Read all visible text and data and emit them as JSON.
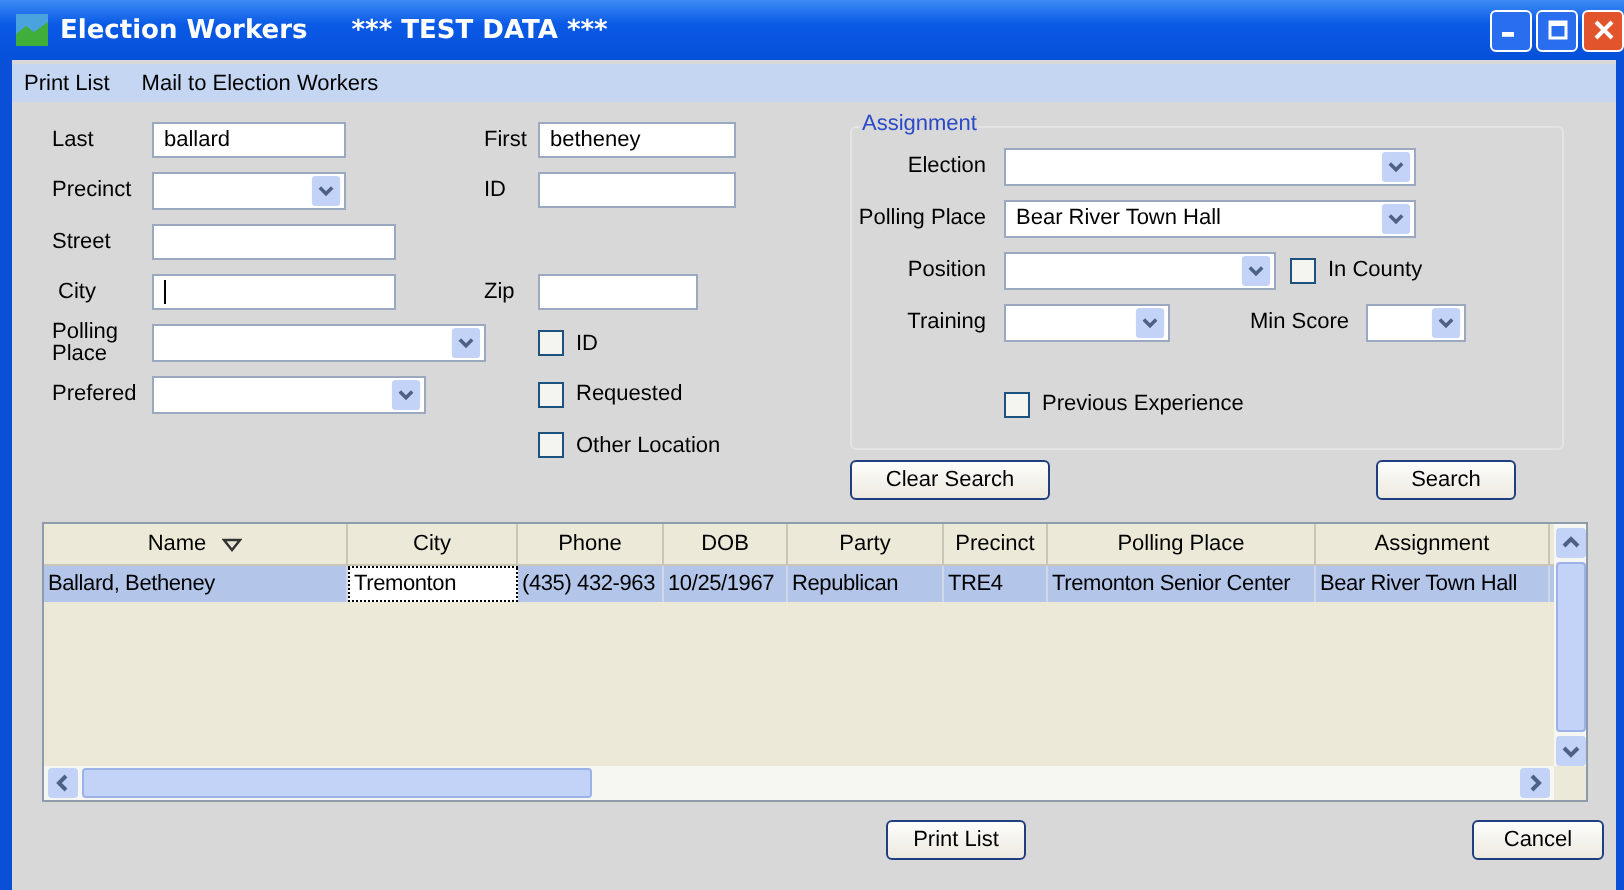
{
  "window": {
    "title": "Election Workers",
    "subtitle": "*** TEST DATA ***"
  },
  "menu": [
    {
      "label": "Print List"
    },
    {
      "label": "Mail to Election Workers"
    }
  ],
  "search": {
    "last": {
      "label": "Last",
      "value": "ballard"
    },
    "first": {
      "label": "First",
      "value": "betheney"
    },
    "precinct": {
      "label": "Precinct"
    },
    "id": {
      "label": "ID"
    },
    "street": {
      "label": "Street"
    },
    "city": {
      "label": "City",
      "focused": true
    },
    "zip": {
      "label": "Zip"
    },
    "polling_place": {
      "label_lines": [
        "Polling",
        "Place"
      ]
    },
    "prefered": {
      "label": "Prefered"
    },
    "checkboxes": [
      {
        "label": "ID",
        "checked": false
      },
      {
        "label": "Requested",
        "checked": false
      },
      {
        "label": "Other Location",
        "checked": false
      }
    ]
  },
  "assignment": {
    "legend": "Assignment",
    "election": {
      "label": "Election"
    },
    "polling_place": {
      "label": "Polling Place",
      "value": "Bear River Town Hall"
    },
    "position": {
      "label": "Position"
    },
    "in_county": {
      "label": "In County",
      "checked": false
    },
    "training": {
      "label": "Training"
    },
    "min_score": {
      "label": "Min Score"
    },
    "previous_experience": {
      "label": "Previous Experience",
      "checked": false
    }
  },
  "search_buttons": [
    {
      "label": "Clear Search"
    },
    {
      "label": "Search"
    }
  ],
  "table": {
    "columns": [
      {
        "label": "Name",
        "sorted": true
      },
      {
        "label": "City",
        "sorted": false
      },
      {
        "label": "Phone",
        "sorted": false
      },
      {
        "label": "DOB",
        "sorted": false
      },
      {
        "label": "Party",
        "sorted": false
      },
      {
        "label": "Precinct",
        "sorted": false
      },
      {
        "label": "Polling Place",
        "sorted": false
      },
      {
        "label": "Assignment",
        "sorted": false
      }
    ],
    "rows": [
      {
        "selected": true,
        "cells": [
          {
            "text": "Ballard, Betheney",
            "focused": false
          },
          {
            "text": "Tremonton",
            "focused": true
          },
          {
            "text": "(435) 432-963",
            "focused": false
          },
          {
            "text": "10/25/1967",
            "focused": false
          },
          {
            "text": "Republican",
            "focused": false
          },
          {
            "text": "TRE4",
            "focused": false
          },
          {
            "text": "Tremonton Senior Center",
            "focused": false
          },
          {
            "text": "Bear River Town Hall",
            "focused": false
          }
        ]
      }
    ]
  },
  "buttons": [
    {
      "label": "Print List"
    },
    {
      "label": "Cancel"
    }
  ]
}
